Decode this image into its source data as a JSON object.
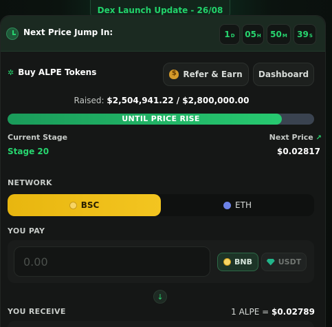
{
  "banner": {
    "text": "Dex Launch Update - 26/08"
  },
  "countdown": {
    "label": "Next Price Jump In:",
    "units": [
      {
        "value": "1",
        "unit": "D"
      },
      {
        "value": "05",
        "unit": "H"
      },
      {
        "value": "50",
        "unit": "M"
      },
      {
        "value": "39",
        "unit": "S"
      }
    ]
  },
  "header": {
    "title": "Buy ALPE Tokens",
    "refer_label": "Refer & Earn",
    "dashboard_label": "Dashboard"
  },
  "raised": {
    "label": "Raised:",
    "value": "$2,504,941.22 / $2,800,000.00",
    "progress_fraction": 0.8946,
    "bar_label": "UNTIL PRICE RISE"
  },
  "stage": {
    "current_label": "Current Stage",
    "current_value": "Stage 20",
    "next_label": "Next Price",
    "next_value": "$0.02817"
  },
  "network": {
    "label": "NETWORK",
    "options": [
      {
        "label": "BSC",
        "selected": true
      },
      {
        "label": "ETH",
        "selected": false
      }
    ]
  },
  "pay": {
    "label": "YOU PAY",
    "placeholder": "0.00",
    "tokens": [
      {
        "label": "BNB",
        "selected": true
      },
      {
        "label": "USDT",
        "selected": false
      }
    ]
  },
  "receive": {
    "label": "YOU RECEIVE",
    "rate_prefix": "1 ALPE =",
    "rate_value": "$0.02789"
  },
  "colors": {
    "accent_green": "#27d56f",
    "bsc_yellow": "#f0c11a",
    "card_bg": "#151716"
  }
}
